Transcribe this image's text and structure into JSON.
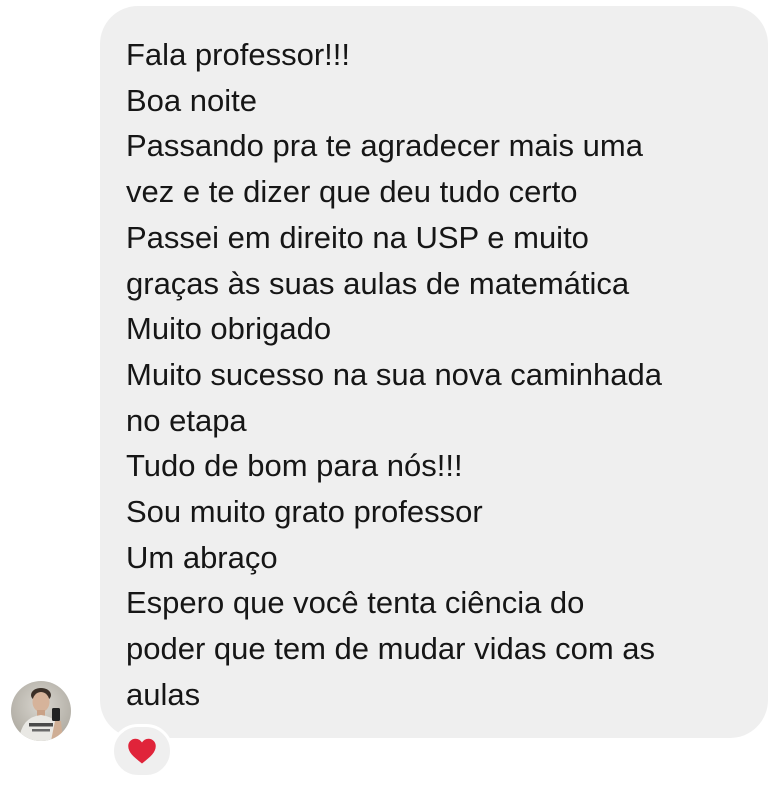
{
  "conversation": {
    "message": {
      "lines": [
        "Fala professor!!!",
        "Boa noite",
        "Passando pra te agradecer mais uma",
        "vez e te dizer que deu tudo certo",
        "Passei em direito na USP e muito",
        "graças às suas aulas de matemática",
        "Muito obrigado",
        "Muito sucesso na sua nova caminhada",
        "no etapa",
        "Tudo de bom para nós!!!",
        "Sou muito grato professor",
        "Um abraço",
        "Espero que você tenta ciência do",
        "poder que tem de mudar vidas com as",
        "aulas"
      ],
      "reaction": {
        "icon": "red-heart-icon",
        "color": "#e0243a"
      }
    },
    "sender": {
      "avatar_icon": "profile-photo"
    }
  },
  "theme": {
    "bubble_color": "#efefef",
    "text_color": "#161616",
    "background": "#ffffff"
  }
}
